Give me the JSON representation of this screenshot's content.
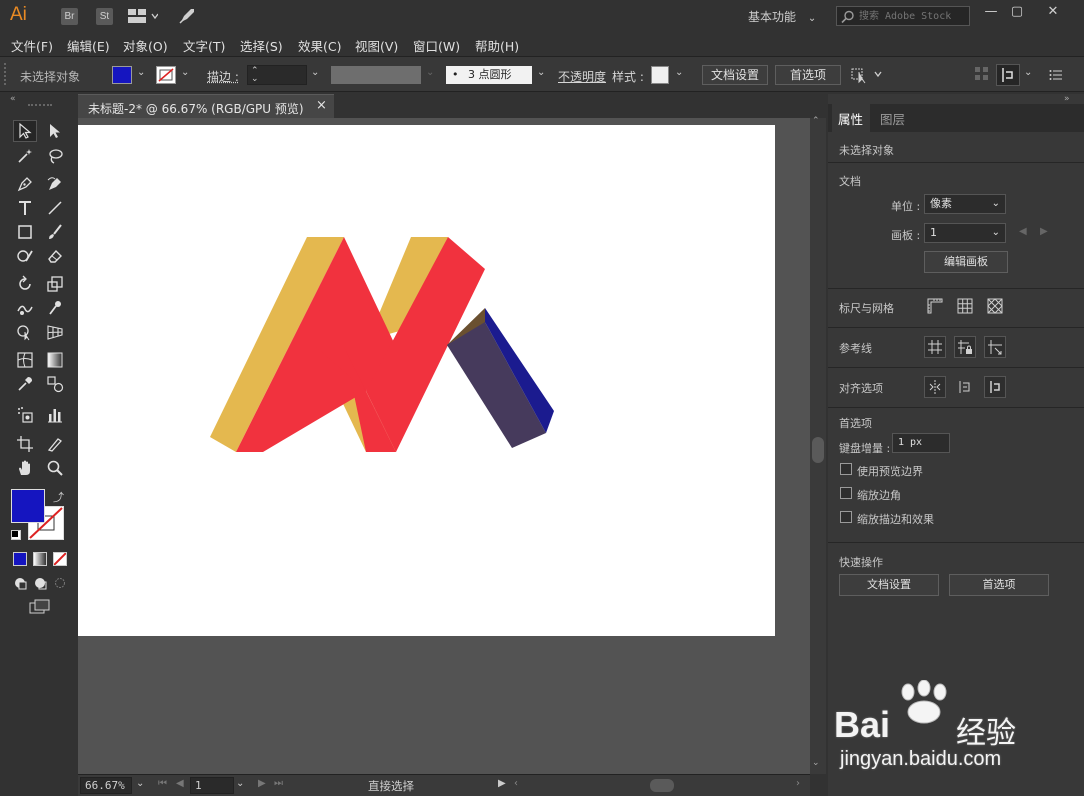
{
  "app": {
    "logo": "Ai",
    "badges": [
      "Br",
      "St"
    ],
    "workspace": "基本功能",
    "search_placeholder": "搜索 Adobe Stock",
    "window_controls": [
      "minimize-icon",
      "restore-icon",
      "close-icon"
    ]
  },
  "menubar": {
    "items": [
      "文件(F)",
      "编辑(E)",
      "对象(O)",
      "文字(T)",
      "选择(S)",
      "效果(C)",
      "视图(V)",
      "窗口(W)",
      "帮助(H)"
    ]
  },
  "control_bar": {
    "selection": "未选择对象",
    "fill_color": "#1515c0",
    "stroke_label": "描边 :",
    "stroke_value": "",
    "brush": "3 点圆形",
    "opacity_label": "不透明度",
    "style_label": "样式 :",
    "doc_setup": "文档设置",
    "preferences": "首选项"
  },
  "document": {
    "tab_title": "未标题-2* @ 66.67% (RGB/GPU 预览)",
    "close_glyph": "×"
  },
  "artwork": {
    "colors": {
      "yellow": "#e4b84f",
      "red": "#f1323e",
      "navy": "#1b1b8f",
      "slate": "#463a5c",
      "bronze": "#6a5030"
    }
  },
  "toolbar": {
    "fill_color": "#1515c0"
  },
  "status_bar": {
    "zoom": "66.67%",
    "artboard": "1",
    "tool": "直接选择"
  },
  "right_panel": {
    "tabs": [
      "属性",
      "图层"
    ],
    "no_selection": "未选择对象",
    "document_title": "文档",
    "units_label": "单位 :",
    "units_value": "像素",
    "artboard_label": "画板 :",
    "artboard_value": "1",
    "edit_artboards": "编辑画板",
    "rulers_grids": "标尺与网格",
    "guides": "参考线",
    "snap_options": "对齐选项",
    "preferences_title": "首选项",
    "keyboard_increment_label": "键盘增量 :",
    "keyboard_increment_value": "1 px",
    "checkboxes": [
      "使用预览边界",
      "缩放边角",
      "缩放描边和效果"
    ],
    "quick_actions": "快速操作",
    "quick_doc_setup": "文档设置",
    "quick_preferences": "首选项"
  },
  "watermark": {
    "brand": "Bai",
    "brand_tail": "经验",
    "url": "jingyan.baidu.com"
  }
}
